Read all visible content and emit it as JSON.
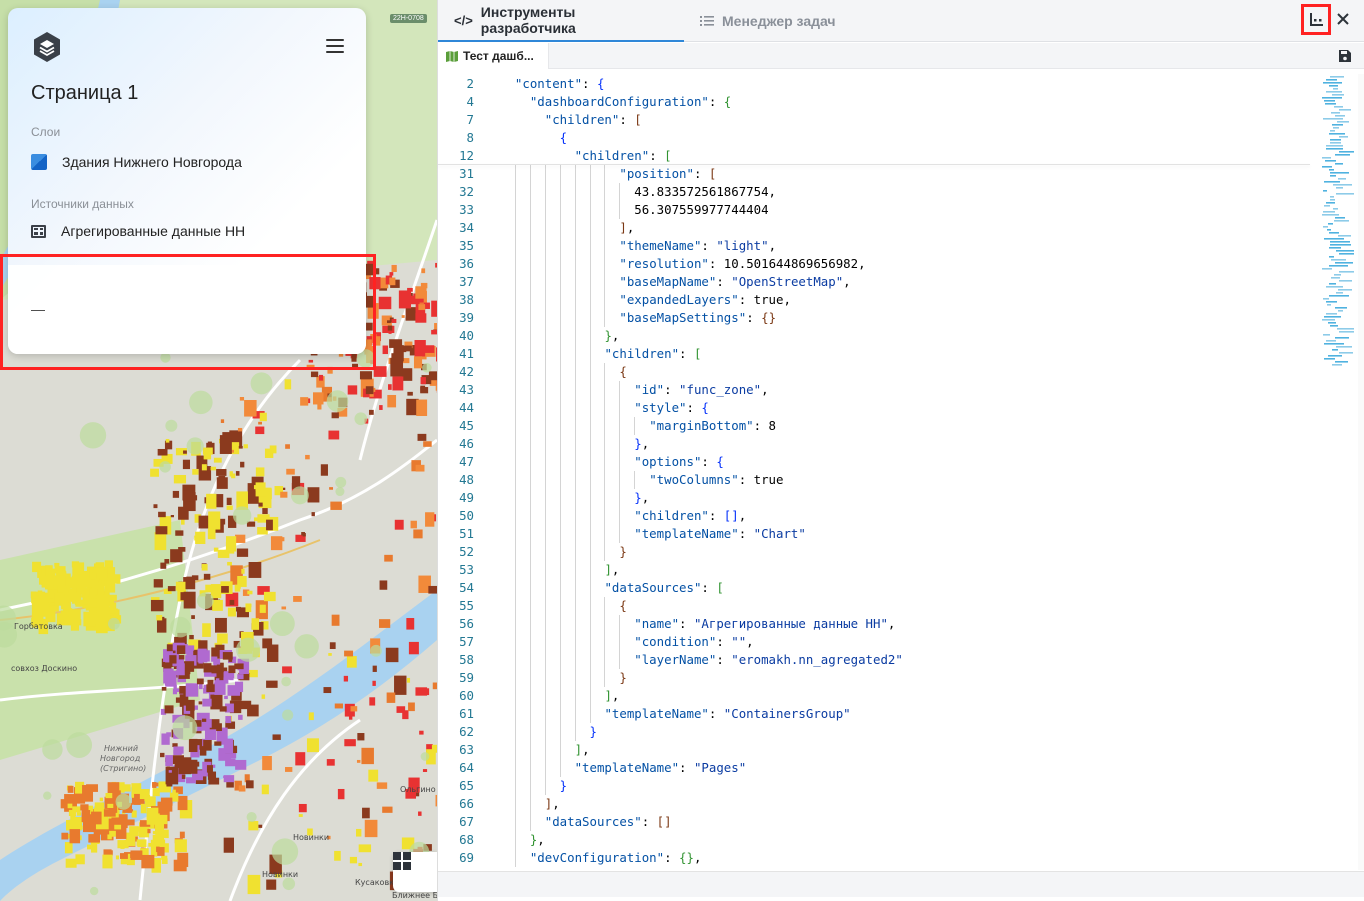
{
  "sidebar": {
    "page_title": "Страница 1",
    "layers_label": "Слои",
    "layers": [
      {
        "label": "Здания Нижнего Новгорода",
        "icon": "layer-icon"
      }
    ],
    "sources_label": "Источники данных",
    "sources": [
      {
        "label": "Агрегированные данные НН",
        "icon": "table-icon"
      }
    ],
    "empty_value": "—"
  },
  "map": {
    "labels": {
      "road": "22Н-0708",
      "gorbatovka": "Горбатовка",
      "doskino": "совхоз Доскино",
      "nn_strigino_1": "Нижний",
      "nn_strigino_2": "Новгород",
      "nn_strigino_3": "(Стригино)",
      "olgino": "Ольгино",
      "novinki": "Новинки",
      "novinki2": "Новинки",
      "kusakovka": "Кусаковка",
      "bor": "Ближнее Бор"
    }
  },
  "devtools": {
    "tabs": [
      {
        "label": "Инструменты разработчика",
        "icon": "code-icon",
        "active": true
      },
      {
        "label": "Менеджер задач",
        "icon": "list-icon",
        "active": false
      }
    ],
    "file_tab": "Тест дашб...",
    "accent_color": "#2f87d8",
    "highlight_color": "#ff2222"
  },
  "code": {
    "sticky": [
      {
        "n": "2",
        "indent": 2,
        "tokens": [
          [
            "key",
            "\"content\""
          ],
          [
            "txt",
            ": "
          ],
          [
            "p0",
            "{"
          ]
        ]
      },
      {
        "n": "4",
        "indent": 4,
        "tokens": [
          [
            "key",
            "\"dashboardConfiguration\""
          ],
          [
            "txt",
            ": "
          ],
          [
            "p1",
            "{"
          ]
        ]
      },
      {
        "n": "7",
        "indent": 6,
        "tokens": [
          [
            "key",
            "\"children\""
          ],
          [
            "txt",
            ": "
          ],
          [
            "p2",
            "["
          ]
        ]
      },
      {
        "n": "8",
        "indent": 8,
        "tokens": [
          [
            "p0",
            "{"
          ]
        ]
      },
      {
        "n": "12",
        "indent": 10,
        "tokens": [
          [
            "key",
            "\"children\""
          ],
          [
            "txt",
            ": "
          ],
          [
            "p1",
            "["
          ]
        ]
      }
    ],
    "lines": [
      {
        "n": "31",
        "indent": 16,
        "tokens": [
          [
            "key",
            "\"position\""
          ],
          [
            "txt",
            ": "
          ],
          [
            "p2",
            "["
          ]
        ]
      },
      {
        "n": "32",
        "indent": 18,
        "tokens": [
          [
            "num",
            "43.833572561867754,"
          ]
        ]
      },
      {
        "n": "33",
        "indent": 18,
        "tokens": [
          [
            "num",
            "56.307559977744404"
          ]
        ]
      },
      {
        "n": "34",
        "indent": 16,
        "tokens": [
          [
            "p2",
            "]"
          ],
          [
            "txt",
            ","
          ]
        ]
      },
      {
        "n": "35",
        "indent": 16,
        "tokens": [
          [
            "key",
            "\"themeName\""
          ],
          [
            "txt",
            ": "
          ],
          [
            "str",
            "\"light\""
          ],
          [
            "txt",
            ","
          ]
        ]
      },
      {
        "n": "36",
        "indent": 16,
        "tokens": [
          [
            "key",
            "\"resolution\""
          ],
          [
            "txt",
            ": 10.501644869656982,"
          ]
        ]
      },
      {
        "n": "37",
        "indent": 16,
        "tokens": [
          [
            "key",
            "\"baseMapName\""
          ],
          [
            "txt",
            ": "
          ],
          [
            "str",
            "\"OpenStreetMap\""
          ],
          [
            "txt",
            ","
          ]
        ]
      },
      {
        "n": "38",
        "indent": 16,
        "tokens": [
          [
            "key",
            "\"expandedLayers\""
          ],
          [
            "txt",
            ": true,"
          ]
        ]
      },
      {
        "n": "39",
        "indent": 16,
        "tokens": [
          [
            "key",
            "\"baseMapSettings\""
          ],
          [
            "txt",
            ": "
          ],
          [
            "p2",
            "{}"
          ]
        ]
      },
      {
        "n": "40",
        "indent": 14,
        "tokens": [
          [
            "p1",
            "}"
          ],
          [
            "txt",
            ","
          ]
        ]
      },
      {
        "n": "41",
        "indent": 14,
        "tokens": [
          [
            "key",
            "\"children\""
          ],
          [
            "txt",
            ": "
          ],
          [
            "p1",
            "["
          ]
        ]
      },
      {
        "n": "42",
        "indent": 16,
        "tokens": [
          [
            "p2",
            "{"
          ]
        ]
      },
      {
        "n": "43",
        "indent": 18,
        "tokens": [
          [
            "key",
            "\"id\""
          ],
          [
            "txt",
            ": "
          ],
          [
            "str",
            "\"func_zone\""
          ],
          [
            "txt",
            ","
          ]
        ]
      },
      {
        "n": "44",
        "indent": 18,
        "tokens": [
          [
            "key",
            "\"style\""
          ],
          [
            "txt",
            ": "
          ],
          [
            "p0",
            "{"
          ]
        ]
      },
      {
        "n": "45",
        "indent": 20,
        "tokens": [
          [
            "key",
            "\"marginBottom\""
          ],
          [
            "txt",
            ": 8"
          ]
        ]
      },
      {
        "n": "46",
        "indent": 18,
        "tokens": [
          [
            "p0",
            "}"
          ],
          [
            "txt",
            ","
          ]
        ]
      },
      {
        "n": "47",
        "indent": 18,
        "tokens": [
          [
            "key",
            "\"options\""
          ],
          [
            "txt",
            ": "
          ],
          [
            "p0",
            "{"
          ]
        ]
      },
      {
        "n": "48",
        "indent": 20,
        "tokens": [
          [
            "key",
            "\"twoColumns\""
          ],
          [
            "txt",
            ": true"
          ]
        ]
      },
      {
        "n": "49",
        "indent": 18,
        "tokens": [
          [
            "p0",
            "}"
          ],
          [
            "txt",
            ","
          ]
        ]
      },
      {
        "n": "50",
        "indent": 18,
        "tokens": [
          [
            "key",
            "\"children\""
          ],
          [
            "txt",
            ": "
          ],
          [
            "p0",
            "[]"
          ],
          [
            "txt",
            ","
          ]
        ]
      },
      {
        "n": "51",
        "indent": 18,
        "tokens": [
          [
            "key",
            "\"templateName\""
          ],
          [
            "txt",
            ": "
          ],
          [
            "str",
            "\"Chart\""
          ]
        ]
      },
      {
        "n": "52",
        "indent": 16,
        "tokens": [
          [
            "p2",
            "}"
          ]
        ]
      },
      {
        "n": "53",
        "indent": 14,
        "tokens": [
          [
            "p1",
            "]"
          ],
          [
            "txt",
            ","
          ]
        ]
      },
      {
        "n": "54",
        "indent": 14,
        "tokens": [
          [
            "key",
            "\"dataSources\""
          ],
          [
            "txt",
            ": "
          ],
          [
            "p1",
            "["
          ]
        ]
      },
      {
        "n": "55",
        "indent": 16,
        "tokens": [
          [
            "p2",
            "{"
          ]
        ]
      },
      {
        "n": "56",
        "indent": 18,
        "tokens": [
          [
            "key",
            "\"name\""
          ],
          [
            "txt",
            ": "
          ],
          [
            "str",
            "\"Агрегированные данные НН\""
          ],
          [
            "txt",
            ","
          ]
        ]
      },
      {
        "n": "57",
        "indent": 18,
        "tokens": [
          [
            "key",
            "\"condition\""
          ],
          [
            "txt",
            ": "
          ],
          [
            "str",
            "\"\""
          ],
          [
            "txt",
            ","
          ]
        ]
      },
      {
        "n": "58",
        "indent": 18,
        "tokens": [
          [
            "key",
            "\"layerName\""
          ],
          [
            "txt",
            ": "
          ],
          [
            "str",
            "\"eromakh.nn_agregated2\""
          ]
        ]
      },
      {
        "n": "59",
        "indent": 16,
        "tokens": [
          [
            "p2",
            "}"
          ]
        ]
      },
      {
        "n": "60",
        "indent": 14,
        "tokens": [
          [
            "p1",
            "]"
          ],
          [
            "txt",
            ","
          ]
        ]
      },
      {
        "n": "61",
        "indent": 14,
        "tokens": [
          [
            "key",
            "\"templateName\""
          ],
          [
            "txt",
            ": "
          ],
          [
            "str",
            "\"ContainersGroup\""
          ]
        ]
      },
      {
        "n": "62",
        "indent": 12,
        "tokens": [
          [
            "p0",
            "}"
          ]
        ]
      },
      {
        "n": "63",
        "indent": 10,
        "tokens": [
          [
            "p1",
            "]"
          ],
          [
            "txt",
            ","
          ]
        ]
      },
      {
        "n": "64",
        "indent": 10,
        "tokens": [
          [
            "key",
            "\"templateName\""
          ],
          [
            "txt",
            ": "
          ],
          [
            "str",
            "\"Pages\""
          ]
        ]
      },
      {
        "n": "65",
        "indent": 8,
        "tokens": [
          [
            "p0",
            "}"
          ]
        ]
      },
      {
        "n": "66",
        "indent": 6,
        "tokens": [
          [
            "p2",
            "]"
          ],
          [
            "txt",
            ","
          ]
        ]
      },
      {
        "n": "67",
        "indent": 6,
        "tokens": [
          [
            "key",
            "\"dataSources\""
          ],
          [
            "txt",
            ": "
          ],
          [
            "p2",
            "[]"
          ]
        ]
      },
      {
        "n": "68",
        "indent": 4,
        "tokens": [
          [
            "p1",
            "}"
          ],
          [
            "txt",
            ","
          ]
        ]
      },
      {
        "n": "69",
        "indent": 4,
        "tokens": [
          [
            "key",
            "\"devConfiguration\""
          ],
          [
            "txt",
            ": "
          ],
          [
            "p1",
            "{}"
          ],
          [
            "txt",
            ","
          ]
        ]
      }
    ]
  }
}
